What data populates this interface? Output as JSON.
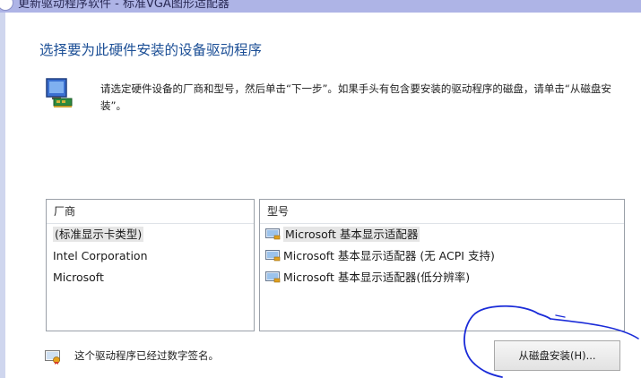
{
  "window": {
    "title": "更新驱动程序软件 - 标准VGA图形适配器"
  },
  "dialog": {
    "heading": "选择要为此硬件安装的设备驱动程序",
    "description": "请选定硬件设备的厂商和型号，然后单击“下一步”。如果手头有包含要安装的驱动程序的磁盘，请单击“从磁盘安装”。",
    "manufacturer_list": {
      "header": "厂商",
      "items": [
        {
          "label": "(标准显示卡类型)",
          "selected": true
        },
        {
          "label": "Intel Corporation",
          "selected": false
        },
        {
          "label": "Microsoft",
          "selected": false
        }
      ]
    },
    "model_list": {
      "header": "型号",
      "items": [
        {
          "label": "Microsoft 基本显示适配器",
          "selected": true
        },
        {
          "label": "Microsoft 基本显示适配器 (无 ACPI 支持)",
          "selected": false
        },
        {
          "label": "Microsoft 基本显示适配器(低分辨率)",
          "selected": false
        }
      ]
    },
    "signed_text": "这个驱动程序已经过数字签名。",
    "have_disk_button": "从磁盘安装(H)...",
    "icons": {
      "hardware": "hardware-install-icon",
      "monitor": "display-adapter-icon",
      "certificate": "digital-signature-icon"
    },
    "annotation_color": "#1a2bd8"
  }
}
